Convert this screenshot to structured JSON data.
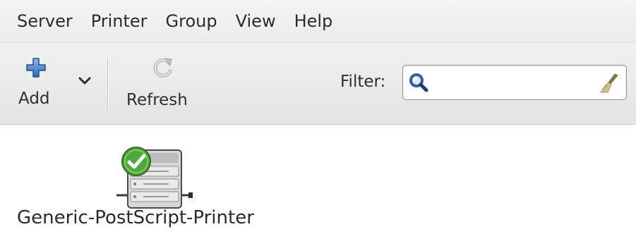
{
  "menubar": {
    "items": [
      {
        "label": "Server"
      },
      {
        "label": "Printer"
      },
      {
        "label": "Group"
      },
      {
        "label": "View"
      },
      {
        "label": "Help"
      }
    ]
  },
  "toolbar": {
    "add": {
      "label": "Add",
      "icon": "plus-icon"
    },
    "add_dropdown": {
      "icon": "chevron-down-icon"
    },
    "refresh": {
      "label": "Refresh",
      "icon": "refresh-icon"
    },
    "filter": {
      "label": "Filter:",
      "value": "",
      "placeholder": "",
      "search_icon": "magnifier-icon",
      "clear_icon": "broom-icon"
    }
  },
  "printers": [
    {
      "name": "Generic-PostScript-Printer",
      "icon": "printer-icon",
      "status": "default",
      "status_icon": "checkmark-icon"
    }
  ],
  "colors": {
    "accent_blue": "#3a74c4",
    "check_green": "#4ea83a",
    "toolbar_bg": "#e8e8e8"
  }
}
